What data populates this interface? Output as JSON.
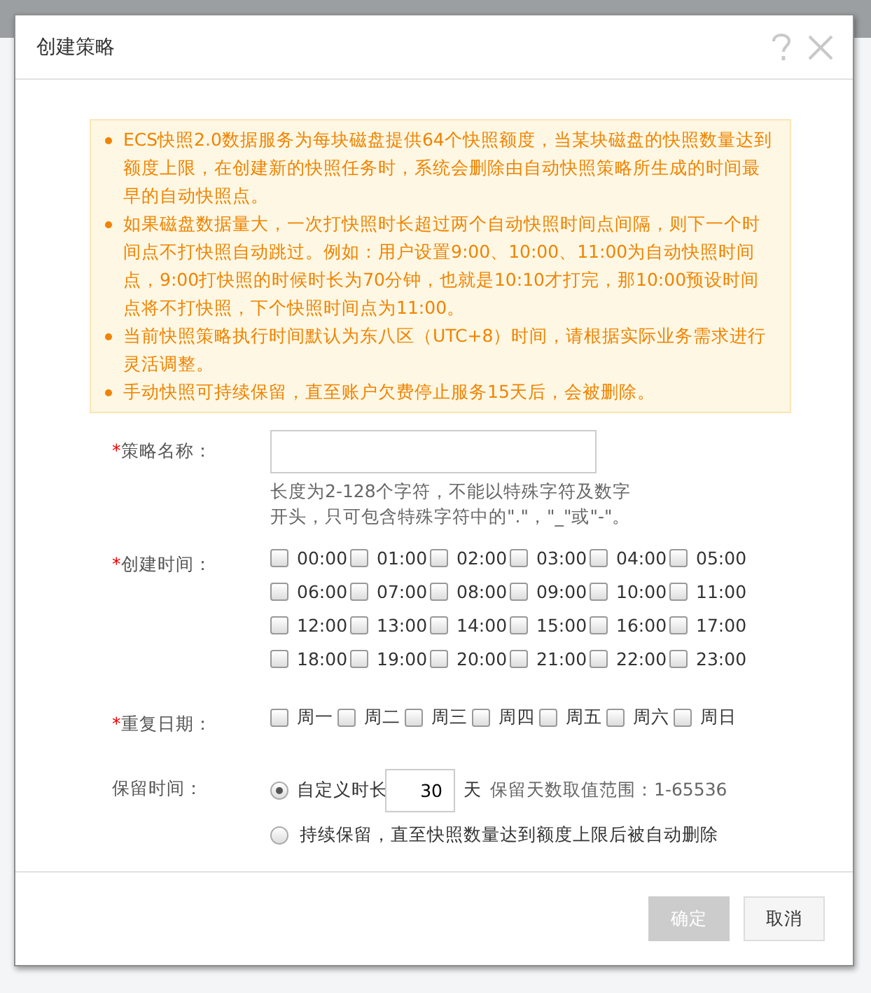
{
  "dialog": {
    "title": "创建策略"
  },
  "notice": [
    "ECS快照2.0数据服务为每块磁盘提供64个快照额度，当某块磁盘的快照数量达到额度上限，在创建新的快照任务时，系统会删除由自动快照策略所生成的时间最早的自动快照点。",
    "如果磁盘数据量大，一次打快照时长超过两个自动快照时间点间隔，则下一个时间点不打快照自动跳过。例如：用户设置9:00、10:00、11:00为自动快照时间点，9:00打快照的时候时长为70分钟，也就是10:10才打完，那10:00预设时间点将不打快照，下个快照时间点为11:00。",
    "当前快照策略执行时间默认为东八区（UTC+8）时间，请根据实际业务需求进行灵活调整。",
    "手动快照可持续保留，直至账户欠费停止服务15天后，会被删除。"
  ],
  "name_field": {
    "mark": "*",
    "label": "策略名称：",
    "hint": "长度为2-128个字符，不能以特殊字符及数字开头，只可包含特殊字符中的\".\"，\"_\"或\"-\"。"
  },
  "create_time": {
    "mark": "*",
    "label": "创建时间：",
    "options": [
      {
        "label": "00:00",
        "checked": false
      },
      {
        "label": "01:00",
        "checked": false
      },
      {
        "label": "02:00",
        "checked": false
      },
      {
        "label": "03:00",
        "checked": false
      },
      {
        "label": "04:00",
        "checked": false
      },
      {
        "label": "05:00",
        "checked": false
      },
      {
        "label": "06:00",
        "checked": false
      },
      {
        "label": "07:00",
        "checked": false
      },
      {
        "label": "08:00",
        "checked": false
      },
      {
        "label": "09:00",
        "checked": false
      },
      {
        "label": "10:00",
        "checked": false
      },
      {
        "label": "11:00",
        "checked": false
      },
      {
        "label": "12:00",
        "checked": false
      },
      {
        "label": "13:00",
        "checked": false
      },
      {
        "label": "14:00",
        "checked": false
      },
      {
        "label": "15:00",
        "checked": false
      },
      {
        "label": "16:00",
        "checked": false
      },
      {
        "label": "17:00",
        "checked": false
      },
      {
        "label": "18:00",
        "checked": false
      },
      {
        "label": "19:00",
        "checked": false
      },
      {
        "label": "20:00",
        "checked": false
      },
      {
        "label": "21:00",
        "checked": false
      },
      {
        "label": "22:00",
        "checked": false
      },
      {
        "label": "23:00",
        "checked": false
      }
    ]
  },
  "repeat_days": {
    "mark": "*",
    "label": "重复日期：",
    "options": [
      {
        "label": "周一",
        "checked": false
      },
      {
        "label": "周二",
        "checked": false
      },
      {
        "label": "周三",
        "checked": false
      },
      {
        "label": "周四",
        "checked": false
      },
      {
        "label": "周五",
        "checked": false
      },
      {
        "label": "周六",
        "checked": false
      },
      {
        "label": "周日",
        "checked": false
      }
    ]
  },
  "retention": {
    "label": "保留时间：",
    "options": [
      {
        "kind": "custom",
        "label": "自定义时长",
        "selected": true,
        "value": "30",
        "unit": "天",
        "hint": "保留天数取值范围：1-65536"
      },
      {
        "kind": "forever",
        "label": "持续保留，直至快照数量达到额度上限后被自动删除",
        "selected": false
      }
    ]
  },
  "buttons": [
    {
      "label": "确定",
      "disabled": true
    },
    {
      "label": "取消",
      "disabled": false
    }
  ]
}
